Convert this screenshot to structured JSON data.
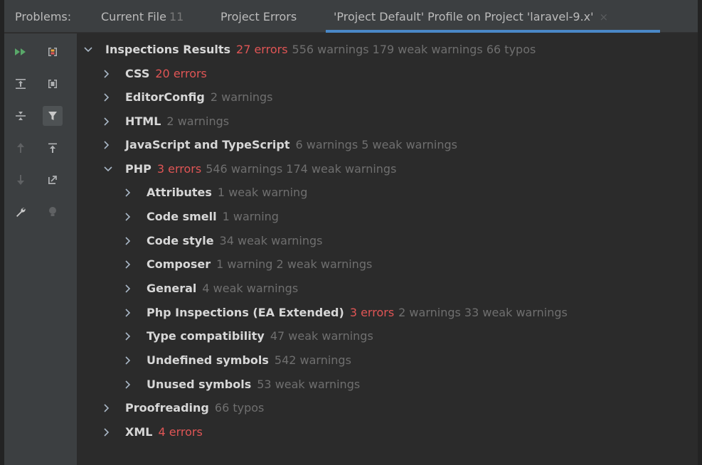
{
  "tabs": {
    "problems_label": "Problems:",
    "current_file": {
      "label": "Current File",
      "count": "11"
    },
    "project_errors": {
      "label": "Project Errors"
    },
    "profile": {
      "label": "'Project Default' Profile on Project 'laravel-9.x'",
      "close": "×"
    }
  },
  "toolbar": {
    "icons": [
      "run-icon",
      "stop-icon",
      "expand-all-icon",
      "layout-icon",
      "collapse-all-icon",
      "filter-icon",
      "up-arrow-icon",
      "export-icon",
      "down-arrow-icon",
      "autoscroll-icon",
      "wrench-icon",
      "lightbulb-icon"
    ]
  },
  "tree": {
    "root": {
      "name": "Inspections Results",
      "errors": "27 errors",
      "rest": "556 warnings 179 weak warnings 66 typos"
    },
    "items": [
      {
        "name": "CSS",
        "errors": "20 errors",
        "rest": ""
      },
      {
        "name": "EditorConfig",
        "errors": "",
        "rest": "2 warnings"
      },
      {
        "name": "HTML",
        "errors": "",
        "rest": "2 warnings"
      },
      {
        "name": "JavaScript and TypeScript",
        "errors": "",
        "rest": "6 warnings 5 weak warnings"
      },
      {
        "name": "PHP",
        "errors": "3 errors",
        "rest": "546 warnings 174 weak warnings"
      },
      {
        "name": "Attributes",
        "errors": "",
        "rest": "1 weak warning"
      },
      {
        "name": "Code smell",
        "errors": "",
        "rest": "1 warning"
      },
      {
        "name": "Code style",
        "errors": "",
        "rest": "34 weak warnings"
      },
      {
        "name": "Composer",
        "errors": "",
        "rest": "1 warning 2 weak warnings"
      },
      {
        "name": "General",
        "errors": "",
        "rest": "4 weak warnings"
      },
      {
        "name": "Php Inspections (EA Extended)",
        "errors": "3 errors",
        "rest": "2 warnings 33 weak warnings"
      },
      {
        "name": "Type compatibility",
        "errors": "",
        "rest": "47 weak warnings"
      },
      {
        "name": "Undefined symbols",
        "errors": "",
        "rest": "542 warnings"
      },
      {
        "name": "Unused symbols",
        "errors": "",
        "rest": "53 weak warnings"
      },
      {
        "name": "Proofreading",
        "errors": "",
        "rest": "66 typos"
      },
      {
        "name": "XML",
        "errors": "4 errors",
        "rest": ""
      }
    ]
  },
  "colors": {
    "error": "#e05555",
    "muted": "#6f6f6f",
    "accent": "#4a88c7",
    "run_green": "#59a869"
  }
}
